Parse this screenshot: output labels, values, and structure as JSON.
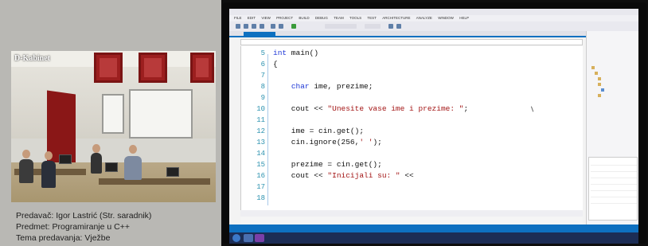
{
  "camera": {
    "label": "D-Kabinet"
  },
  "captions": {
    "lecturer": "Predavač: Igor Lastrić (Str. saradnik)",
    "subject": "Predmet: Programiranje u C++",
    "topic": "Tema predavanja: Vježbe"
  },
  "ide": {
    "menu_items": [
      "FILE",
      "EDIT",
      "VIEW",
      "PROJECT",
      "BUILD",
      "DEBUG",
      "TEAM",
      "TOOLS",
      "TEST",
      "ARCHITECTURE",
      "ANALYZE",
      "WINDOW",
      "HELP"
    ],
    "accent_color": "#0e70c0",
    "code_lines": [
      {
        "num": "5",
        "text": "int main()"
      },
      {
        "num": "6",
        "text": "{"
      },
      {
        "num": "7",
        "text": ""
      },
      {
        "num": "8",
        "text": "    char ime, prezime;"
      },
      {
        "num": "9",
        "text": ""
      },
      {
        "num": "10",
        "text": "    cout << \"Unesite vase ime i prezime: \";"
      },
      {
        "num": "11",
        "text": ""
      },
      {
        "num": "12",
        "text": "    ime = cin.get();"
      },
      {
        "num": "13",
        "text": "    cin.ignore(256,' ');"
      },
      {
        "num": "14",
        "text": ""
      },
      {
        "num": "15",
        "text": "    prezime = cin.get();"
      },
      {
        "num": "16",
        "text": "    cout << \"Inicijali su: \" <<"
      },
      {
        "num": "17",
        "text": ""
      },
      {
        "num": "18",
        "text": ""
      }
    ]
  }
}
